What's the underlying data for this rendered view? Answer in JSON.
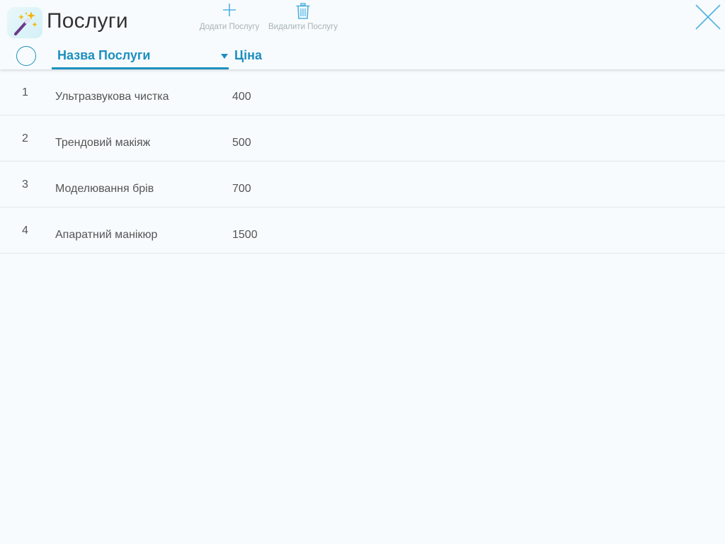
{
  "header": {
    "title": "Послуги",
    "app_icon": "magic-wand-icon",
    "actions": {
      "add_label": "Додати Послугу",
      "add_icon": "plus-icon",
      "delete_label": "Видалити Послугу",
      "delete_icon": "trash-icon"
    },
    "close_icon": "close-icon"
  },
  "table": {
    "columns": {
      "name": "Назва Послуги",
      "price": "Ціна",
      "sort": "descending"
    },
    "rows": [
      {
        "index": "1",
        "name": "Ультразвукова чистка",
        "price": "400"
      },
      {
        "index": "2",
        "name": "Трендовий макіяж",
        "price": "500"
      },
      {
        "index": "3",
        "name": "Моделювання брів",
        "price": "700"
      },
      {
        "index": "4",
        "name": "Апаратний манікюр",
        "price": "1500"
      }
    ]
  },
  "colors": {
    "accent": "#1e8fbf",
    "background": "#f7fbfd",
    "muted_text": "#a9b2b8"
  }
}
